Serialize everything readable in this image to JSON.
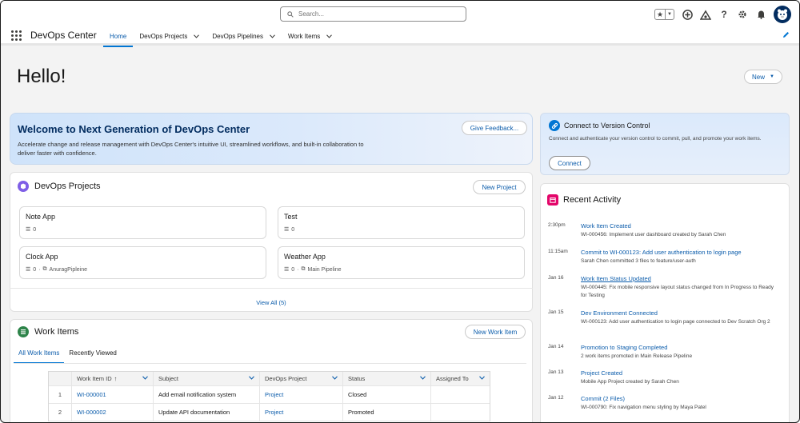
{
  "search": {
    "placeholder": "Search..."
  },
  "app": {
    "name": "DevOps Center"
  },
  "nav": {
    "tabs": [
      {
        "label": "Home"
      },
      {
        "label": "DevOps Projects"
      },
      {
        "label": "DevOps Pipelines"
      },
      {
        "label": "Work Items"
      }
    ]
  },
  "page": {
    "greeting": "Hello!",
    "new_button": "New"
  },
  "welcome": {
    "title": "Welcome to Next Generation of DevOps Center",
    "text": "Accelerate change and release management with DevOps Center's intuitive UI, streamlined workflows, and built-in collaboration to deliver faster with confidence.",
    "feedback_button": "Give Feedback..."
  },
  "version_control": {
    "title": "Connect to Version Control",
    "text": "Connect and authenticate your version control to commit, pull, and promote your work items.",
    "button": "Connect"
  },
  "projects": {
    "title": "DevOps Projects",
    "new_button": "New Project",
    "view_all": "View All (5)",
    "items": [
      {
        "name": "Note App",
        "count": "0",
        "pipeline": ""
      },
      {
        "name": "Test",
        "count": "0",
        "pipeline": ""
      },
      {
        "name": "Clock App",
        "count": "0",
        "pipeline": "AnuragPipleine"
      },
      {
        "name": "Weather App",
        "count": "0",
        "pipeline": "Main Pipeline"
      }
    ]
  },
  "work_items": {
    "title": "Work Items",
    "new_button": "New Work Item",
    "tabs": [
      {
        "label": "All Work Items"
      },
      {
        "label": "Recently Viewed"
      }
    ],
    "columns": [
      "Work Item ID",
      "Subject",
      "DevOps Project",
      "Status",
      "Assigned To"
    ],
    "sort_indicator": "↑",
    "rows": [
      {
        "num": "1",
        "id": "WI-000001",
        "subject": "Add email notification system",
        "project": "Project",
        "status": "Closed",
        "assigned": ""
      },
      {
        "num": "2",
        "id": "WI-000002",
        "subject": "Update API documentation",
        "project": "Project",
        "status": "Promoted",
        "assigned": ""
      }
    ]
  },
  "recent_activity": {
    "title": "Recent Activity",
    "items": [
      {
        "time": "2:30pm",
        "title": "Work Item Created",
        "desc": "WI-000456: Implement user dashboard created by Sarah Chen"
      },
      {
        "time": "11:15am",
        "title": "Commit to WI-000123: Add user authentication to login page",
        "desc": "Sarah Chen committed 3 files to feature/user-auth"
      },
      {
        "time": "Jan 16",
        "title": "Work Item Status Updated",
        "desc": "WI-000445: Fix mobile responsive layout status changed from In Progress to Ready for Testing"
      },
      {
        "time": "Jan 15",
        "title": "Dev Environment Connected",
        "desc": "WI-000123: Add user authentication to login page connected to Dev Scratch Org 2"
      },
      {
        "time": "Jan 14",
        "title": "Promotion to Staging Completed",
        "desc": "2 work items promoted in Main Release Pipeline"
      },
      {
        "time": "Jan 13",
        "title": "Project Created",
        "desc": "Mobile App Project created by Sarah Chen"
      },
      {
        "time": "Jan 12",
        "title": "Commit (2 Files)",
        "desc": "WI-000790: Fix navigation menu styling by Maya Patel"
      }
    ]
  },
  "colors": {
    "brand_blue": "#0176d3",
    "link_blue": "#0b5cab",
    "navy": "#032d60",
    "activity_pink": "#e3066a",
    "projects_purple": "#7f5fe6",
    "work_items_green": "#2e844a"
  }
}
